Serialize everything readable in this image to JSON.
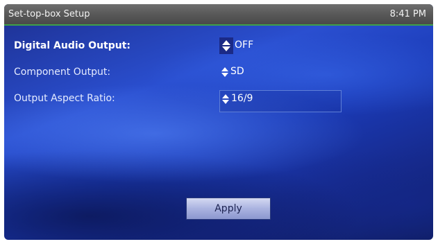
{
  "header": {
    "title": "Set-top-box Setup",
    "clock": "8:41 PM"
  },
  "settings": [
    {
      "label": "Digital Audio Output:",
      "value": "OFF",
      "focused": true
    },
    {
      "label": "Component Output:",
      "value": "SD",
      "focused": false
    },
    {
      "label": "Output Aspect Ratio:",
      "value": "16/9",
      "focused": false
    }
  ],
  "actions": {
    "apply_label": "Apply"
  },
  "colors": {
    "title_bar": "#585858",
    "accent_line": "#3fa04a",
    "background": "#2a4fd0",
    "button": "#aab3e0"
  },
  "icons": {
    "spinner": "up-down-arrows-icon"
  }
}
